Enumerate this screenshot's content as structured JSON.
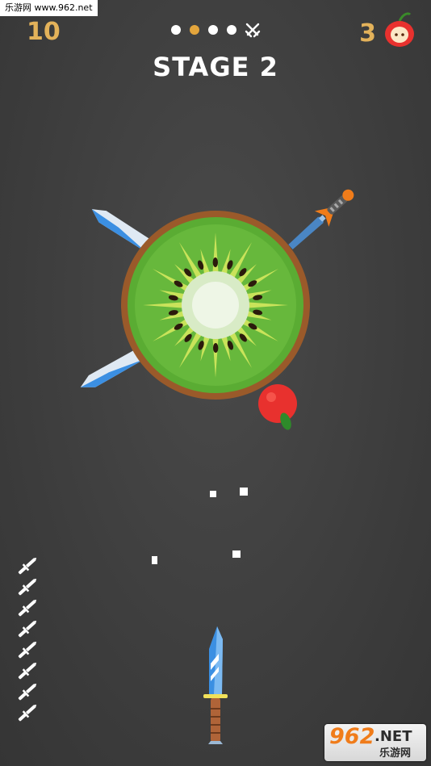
{
  "watermark": {
    "text": "乐游网 www.962.net"
  },
  "hud": {
    "score": "10",
    "apple_count": "3",
    "stage_title": "STAGE 2",
    "stage_progress": {
      "total": 4,
      "current": 2
    }
  },
  "knives_remaining": 8,
  "logo": {
    "line1": "962",
    "line2": ".NET",
    "line3": "乐游网"
  },
  "colors": {
    "background": "#414141",
    "accent_gold": "#e3b25a",
    "kiwi_green": "#5aac33",
    "kiwi_rim": "#9a5a2a",
    "apple_red": "#e8312e"
  }
}
